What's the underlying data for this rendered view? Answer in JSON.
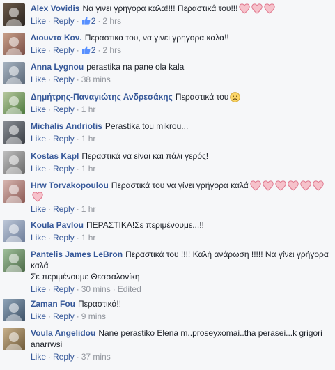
{
  "labels": {
    "like": "Like",
    "reply": "Reply",
    "sep": "·",
    "edited": "Edited"
  },
  "colors": {
    "link": "#365899",
    "meta": "#90949c",
    "heart_fill": "#f6c2cb",
    "heart_stroke": "#e0788e"
  },
  "comments": [
    {
      "name": "Alex Vovidis",
      "text": "Να γινει γρηγορα καλα!!!! Περαστικά του!!!",
      "likes": "2",
      "time": "2 hrs",
      "hearts": 3,
      "edited": false
    },
    {
      "name": "Λιουντα Κον.",
      "text": "Περαστικα του, να γινει γρηγορα καλα!!",
      "likes": "2",
      "time": "2 hrs",
      "hearts": 0,
      "edited": false
    },
    {
      "name": "Anna Lygnou",
      "text": "perastika na pane ola kala",
      "likes": "",
      "time": "38 mins",
      "hearts": 0,
      "edited": false
    },
    {
      "name": "Δημήτρης-Παναγιώτης Ανδρεσάκης",
      "text": "Περαστικά του",
      "likes": "",
      "time": "1 hr",
      "hearts": 0,
      "emoji": "sad",
      "edited": false
    },
    {
      "name": "Michalis Andriotis",
      "text": "Perastika tou mikrou...",
      "likes": "",
      "time": "1 hr",
      "hearts": 0,
      "edited": false
    },
    {
      "name": "Kostas Kapl",
      "text": "Περαστικά να είναι και πάλι γερός!",
      "likes": "",
      "time": "1 hr",
      "hearts": 0,
      "edited": false
    },
    {
      "name": "Hrw Torvakopoulou",
      "text": "Περαστικά του να γίνει γρήγορα καλά",
      "likes": "",
      "time": "1 hr",
      "hearts": 7,
      "edited": false
    },
    {
      "name": "Koula Pavlou",
      "text": "ΠΕΡΑΣΤΙΚΑ!Σε περιμένουμε...!!",
      "likes": "",
      "time": "1 hr",
      "hearts": 0,
      "edited": false
    },
    {
      "name": "Pantelis James LeBron",
      "text": "Περαστικά του !!!! Καλή ανάρωση !!!!! Να γίνει γρήγορα καλά",
      "text2": "Σε περιμένουμε Θεσσαλονίκη",
      "likes": "",
      "time": "30 mins",
      "hearts": 0,
      "edited": true
    },
    {
      "name": "Zaman Fou",
      "text": "Περαστικά!!",
      "likes": "",
      "time": "9 mins",
      "hearts": 0,
      "edited": false
    },
    {
      "name": "Voula Angelidou",
      "text": "Nane perastiko Elena m..proseyxomai..tha perasei...k grigori anarrwsi",
      "likes": "",
      "time": "37 mins",
      "hearts": 0,
      "edited": false
    }
  ]
}
